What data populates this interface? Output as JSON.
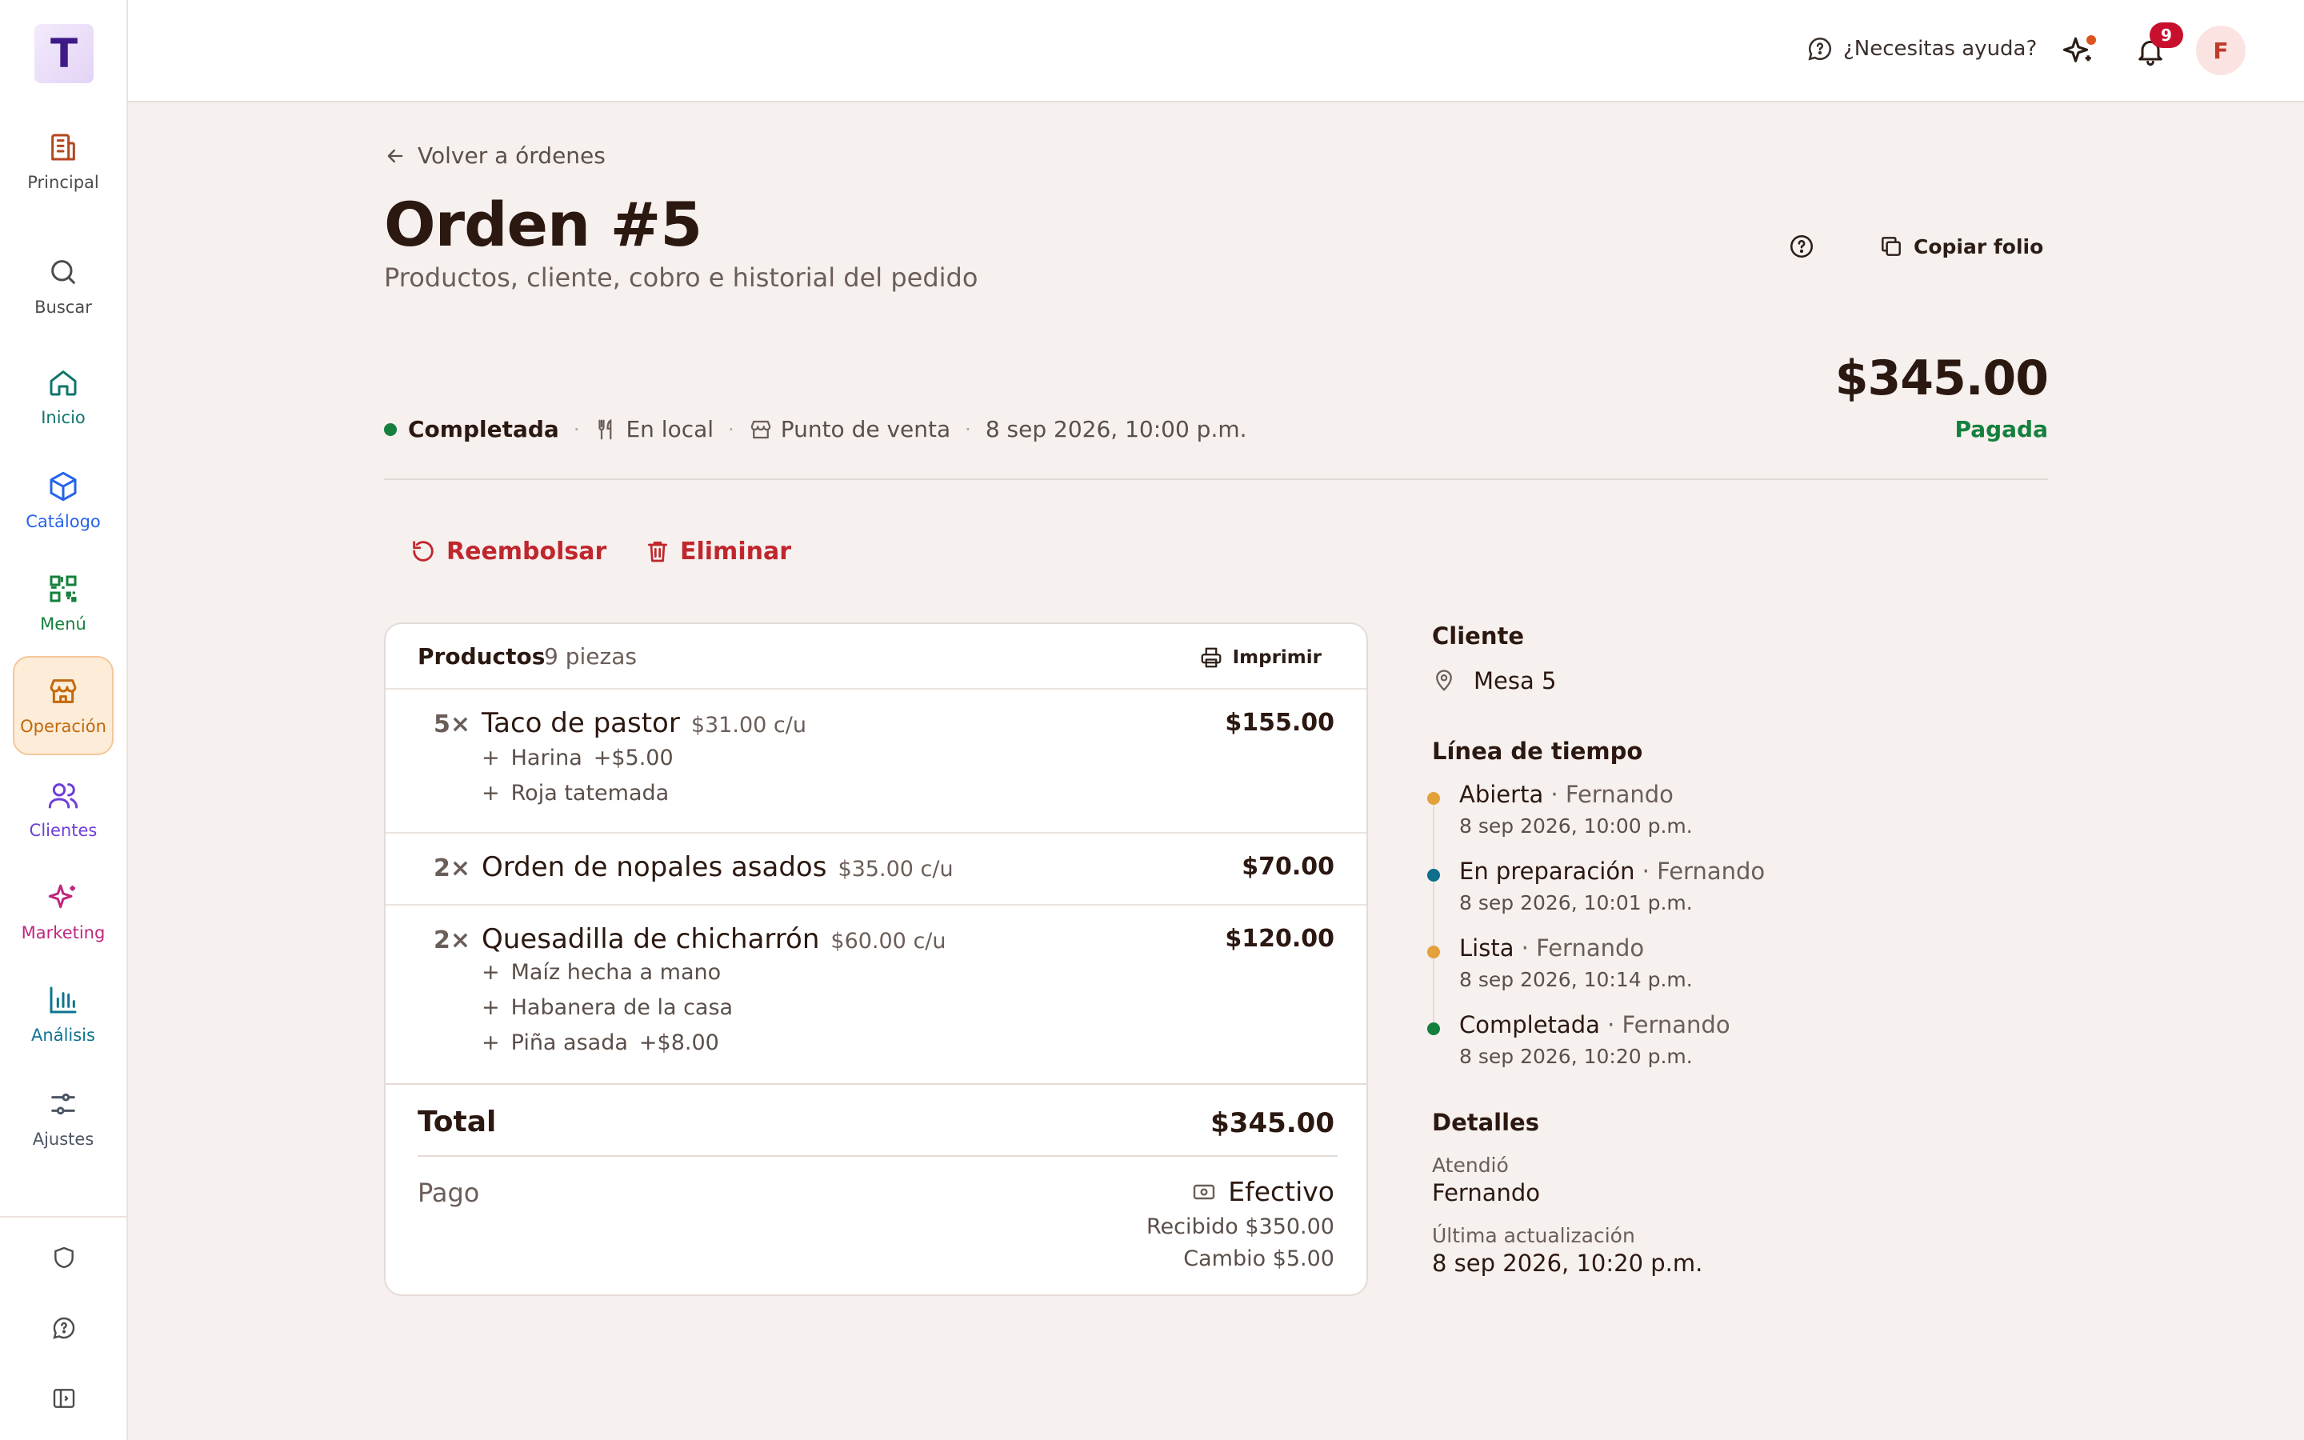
{
  "app": {
    "logo_letter": "T",
    "brand_color": "#3e1a86"
  },
  "sidebar": {
    "items": [
      {
        "label": "Principal",
        "icon": "building-icon",
        "color": "#b4471f"
      },
      {
        "label": "Buscar",
        "icon": "search-icon",
        "color": "#4b4b4b"
      },
      {
        "label": "Inicio",
        "icon": "home-icon",
        "color": "#0f766e"
      },
      {
        "label": "Catálogo",
        "icon": "box-icon",
        "color": "#2563eb"
      },
      {
        "label": "Menú",
        "icon": "qr-code-icon",
        "color": "#15803d"
      },
      {
        "label": "Operación",
        "icon": "store-icon",
        "color": "#c2680c",
        "active": true
      },
      {
        "label": "Clientes",
        "icon": "users-icon",
        "color": "#6d3fd9"
      },
      {
        "label": "Marketing",
        "icon": "sparkles-icon",
        "color": "#c0267e"
      },
      {
        "label": "Análisis",
        "icon": "bar-chart-icon",
        "color": "#0e7490"
      },
      {
        "label": "Ajustes",
        "icon": "sliders-icon",
        "color": "#4b5563"
      }
    ],
    "bottom": [
      "shield-icon",
      "chat-help-icon",
      "collapse-sidebar-icon"
    ]
  },
  "topbar": {
    "help_label": "¿Necesitas ayuda?",
    "notifications_count": "9",
    "avatar_initial": "F"
  },
  "page": {
    "back_label": "Volver a órdenes",
    "title": "Orden #5",
    "subtitle": "Productos, cliente, cobro e historial del pedido",
    "copy_label": "Copiar folio",
    "total_amount": "$345.00",
    "payment_status": "Pagada",
    "status": "Completada",
    "service_type": "En local",
    "channel": "Punto de venta",
    "datetime": "8 sep 2026, 10:00 p.m.",
    "refund_label": "Reembolsar",
    "delete_label": "Eliminar"
  },
  "products": {
    "title": "Productos",
    "count": "9 piezas",
    "print_label": "Imprimir",
    "items": [
      {
        "qty": "5×",
        "name": "Taco de pastor",
        "unit": "$31.00 c/u",
        "amount": "$155.00",
        "mods": [
          {
            "sign": "+",
            "name": "Harina",
            "extra": "+$5.00"
          },
          {
            "sign": "+",
            "name": "Roja tatemada",
            "extra": ""
          }
        ]
      },
      {
        "qty": "2×",
        "name": "Orden de nopales asados",
        "unit": "$35.00 c/u",
        "amount": "$70.00",
        "mods": []
      },
      {
        "qty": "2×",
        "name": "Quesadilla de chicharrón",
        "unit": "$60.00 c/u",
        "amount": "$120.00",
        "mods": [
          {
            "sign": "+",
            "name": "Maíz hecha a mano",
            "extra": ""
          },
          {
            "sign": "+",
            "name": "Habanera de la casa",
            "extra": ""
          },
          {
            "sign": "+",
            "name": "Piña asada",
            "extra": "+$8.00"
          }
        ]
      }
    ],
    "total_label": "Total",
    "total_value": "$345.00",
    "payment_label": "Pago",
    "payment_method": "Efectivo",
    "received": "Recibido $350.00",
    "change": "Cambio $5.00"
  },
  "client": {
    "title": "Cliente",
    "location": "Mesa 5"
  },
  "timeline": {
    "title": "Línea de tiempo",
    "events": [
      {
        "status": "Abierta",
        "by": " · Fernando",
        "time": "8 sep 2026, 10:00 p.m.",
        "color": "#e1a23a"
      },
      {
        "status": "En preparación",
        "by": " · Fernando",
        "time": "8 sep 2026, 10:01 p.m.",
        "color": "#0e6e8c"
      },
      {
        "status": "Lista",
        "by": " · Fernando",
        "time": "8 sep 2026, 10:14 p.m.",
        "color": "#e1a23a"
      },
      {
        "status": "Completada",
        "by": " · Fernando",
        "time": "8 sep 2026, 10:20 p.m.",
        "color": "#15803d"
      }
    ]
  },
  "details": {
    "title": "Detalles",
    "attended_label": "Atendió",
    "attended_value": "Fernando",
    "updated_label": "Última actualización",
    "updated_value": "8 sep 2026, 10:20 p.m."
  }
}
